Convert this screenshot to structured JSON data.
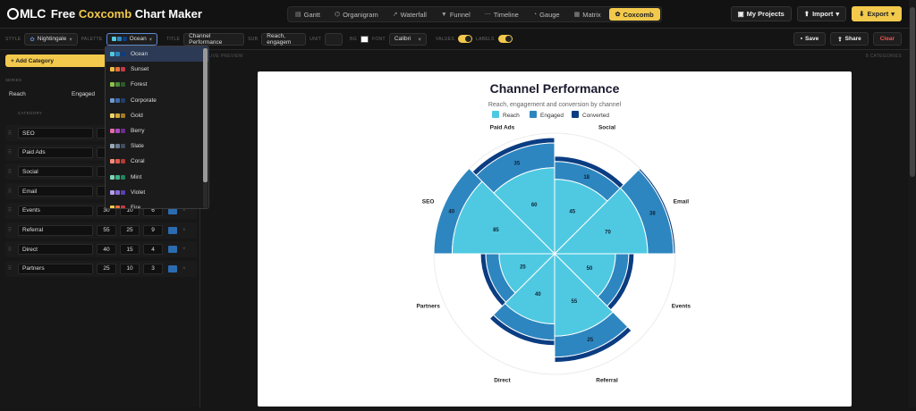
{
  "app": {
    "logo": "MLC",
    "title_prefix": "Free ",
    "title_accent": "Coxcomb",
    "title_suffix": " Chart Maker"
  },
  "chart_tabs": [
    {
      "label": "Gantt",
      "icon": "gantt-icon",
      "glyph": "▤"
    },
    {
      "label": "Organigram",
      "icon": "organigram-icon",
      "glyph": "⌬"
    },
    {
      "label": "Waterfall",
      "icon": "waterfall-icon",
      "glyph": "↗"
    },
    {
      "label": "Funnel",
      "icon": "funnel-icon",
      "glyph": "▼"
    },
    {
      "label": "Timeline",
      "icon": "timeline-icon",
      "glyph": "⋯"
    },
    {
      "label": "Gauge",
      "icon": "gauge-icon",
      "glyph": "◔"
    },
    {
      "label": "Matrix",
      "icon": "matrix-icon",
      "glyph": "▦"
    },
    {
      "label": "Coxcomb",
      "icon": "coxcomb-icon",
      "glyph": "✿",
      "active": true
    }
  ],
  "top_actions": {
    "my_projects": "My Projects",
    "import": "Import",
    "export": "Export"
  },
  "toolbar": {
    "style_label": "STYLE",
    "style_value": "Nightingale",
    "palette_label": "PALETTE",
    "palette_value": "Ocean",
    "title_label": "TITLE",
    "title_value": "Channel Performance",
    "sub_label": "SUB",
    "sub_value": "Reach, engagem",
    "unit_label": "UNIT",
    "unit_value": "",
    "bg_label": "BG",
    "font_label": "FONT",
    "font_value": "Calibri",
    "values_label": "VALUES",
    "labels_label": "LABELS",
    "save": "Save",
    "share": "Share",
    "clear": "Clear"
  },
  "sidebar": {
    "add_category": "+ Add Category",
    "series_label": "SERIES",
    "series": [
      "Reach",
      "Engaged"
    ],
    "category_header": "CATEGORY",
    "rows": [
      {
        "name": "SEO",
        "v1": "",
        "v2": "",
        "v3": ""
      },
      {
        "name": "Paid Ads",
        "v1": "",
        "v2": "",
        "v3": ""
      },
      {
        "name": "Social",
        "v1": "",
        "v2": "",
        "v3": ""
      },
      {
        "name": "Email",
        "v1": "",
        "v2": "",
        "v3": ""
      },
      {
        "name": "Events",
        "v1": "30",
        "v2": "10",
        "v3": "6",
        "color": "#2b6cb0"
      },
      {
        "name": "Referral",
        "v1": "55",
        "v2": "25",
        "v3": "9",
        "color": "#2b6cb0"
      },
      {
        "name": "Direct",
        "v1": "40",
        "v2": "15",
        "v3": "4",
        "color": "#2b6cb0"
      },
      {
        "name": "Partners",
        "v1": "25",
        "v2": "10",
        "v3": "3",
        "color": "#2b6cb0"
      }
    ]
  },
  "palette_dropdown": [
    {
      "name": "Ocean",
      "colors": [
        "#4fc9e2",
        "#2d86c0",
        "#0b3d82"
      ],
      "active": true
    },
    {
      "name": "Sunset",
      "colors": [
        "#f4b942",
        "#e8703a",
        "#c23b4a"
      ]
    },
    {
      "name": "Forest",
      "colors": [
        "#8bc34a",
        "#4c8c3a",
        "#2e5a2a"
      ]
    },
    {
      "name": "Corporate",
      "colors": [
        "#6b9bd2",
        "#3d6aa8",
        "#1f3d6e"
      ]
    },
    {
      "name": "Gold",
      "colors": [
        "#f2d36b",
        "#d4a93b",
        "#a37a1f"
      ]
    },
    {
      "name": "Berry",
      "colors": [
        "#e06ba8",
        "#a84bc2",
        "#6d2c8c"
      ]
    },
    {
      "name": "Slate",
      "colors": [
        "#9aa8b8",
        "#6b7c90",
        "#3f4d5e"
      ]
    },
    {
      "name": "Coral",
      "colors": [
        "#f48a7a",
        "#e0584a",
        "#b33a30"
      ]
    },
    {
      "name": "Mint",
      "colors": [
        "#7fd6b0",
        "#3db38a",
        "#20845f"
      ]
    },
    {
      "name": "Violet",
      "colors": [
        "#b59cf0",
        "#8a6ad8",
        "#5a3fb0"
      ]
    },
    {
      "name": "Fire",
      "colors": [
        "#f2c94c",
        "#e8703a",
        "#c23b4a"
      ]
    }
  ],
  "preview": {
    "label": "LIVE PREVIEW",
    "count": "8 CATEGORIES"
  },
  "chart_data": {
    "type": "coxcomb",
    "title": "Channel Performance",
    "subtitle": "Reach, engagement and conversion by channel",
    "series": [
      {
        "name": "Reach",
        "color": "#4fc9e2"
      },
      {
        "name": "Engaged",
        "color": "#2d86c0"
      },
      {
        "name": "Converted",
        "color": "#0b3d82"
      }
    ],
    "categories": [
      "Social",
      "Email",
      "Events",
      "Referral",
      "Direct",
      "Partners",
      "SEO",
      "Paid Ads"
    ],
    "reach": [
      45,
      70,
      30,
      55,
      40,
      25,
      85,
      60
    ],
    "engaged": [
      18,
      38,
      10,
      25,
      15,
      10,
      40,
      35
    ],
    "converted": [
      5,
      12,
      6,
      9,
      4,
      3,
      11,
      10
    ],
    "reach_labels": [
      "45",
      "70",
      "50",
      "55",
      "40",
      "25",
      "85",
      "60"
    ],
    "engaged_labels": [
      "18",
      "38",
      "",
      "25",
      "",
      "",
      "40",
      "35"
    ]
  }
}
